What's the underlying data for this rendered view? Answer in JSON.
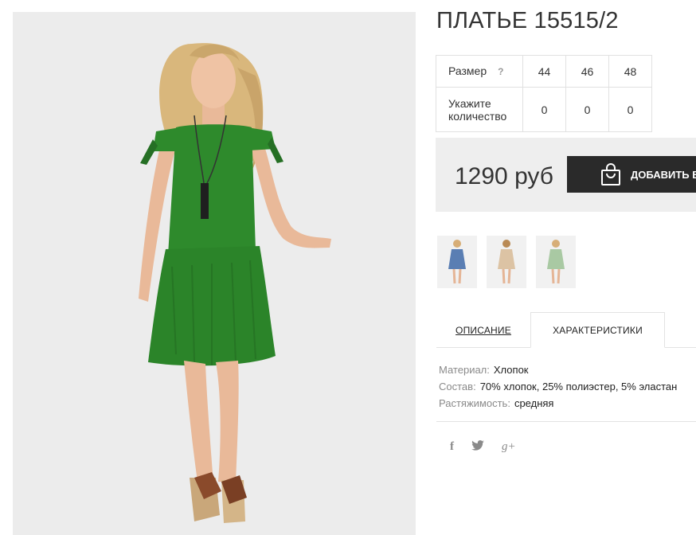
{
  "product": {
    "title": "ПЛАТЬЕ 15515/2"
  },
  "size_table": {
    "size_label": "Размер",
    "help_glyph": "?",
    "qty_label": "Укажите количество",
    "sizes": [
      "44",
      "46",
      "48"
    ],
    "quantities": [
      "0",
      "0",
      "0"
    ]
  },
  "purchase": {
    "price": "1290 руб",
    "add_label": "ДОБАВИТЬ В"
  },
  "thumbnails": [
    {
      "name": "thumb-blue-dress",
      "dress_color": "#5a7eb3"
    },
    {
      "name": "thumb-beige-dress",
      "dress_color": "#dcc3a4"
    },
    {
      "name": "thumb-mint-dress",
      "dress_color": "#a9c9a3"
    }
  ],
  "tabs": {
    "description": "ОПИСАНИЕ",
    "specs": "ХАРАКТЕРИСТИКИ"
  },
  "specs": [
    {
      "key": "Материал:",
      "value": "Хлопок"
    },
    {
      "key": "Состав:",
      "value": "70% хлопок, 25% полиэстер, 5% эластан"
    },
    {
      "key": "Растяжимость:",
      "value": "средняя"
    }
  ],
  "social": {
    "facebook": "f",
    "twitter": "🐦",
    "gplus": "g+"
  },
  "colors": {
    "dress_main": "#2e8a2c",
    "button_bg": "#2a2a2a",
    "price_bg": "#eeeeee"
  }
}
